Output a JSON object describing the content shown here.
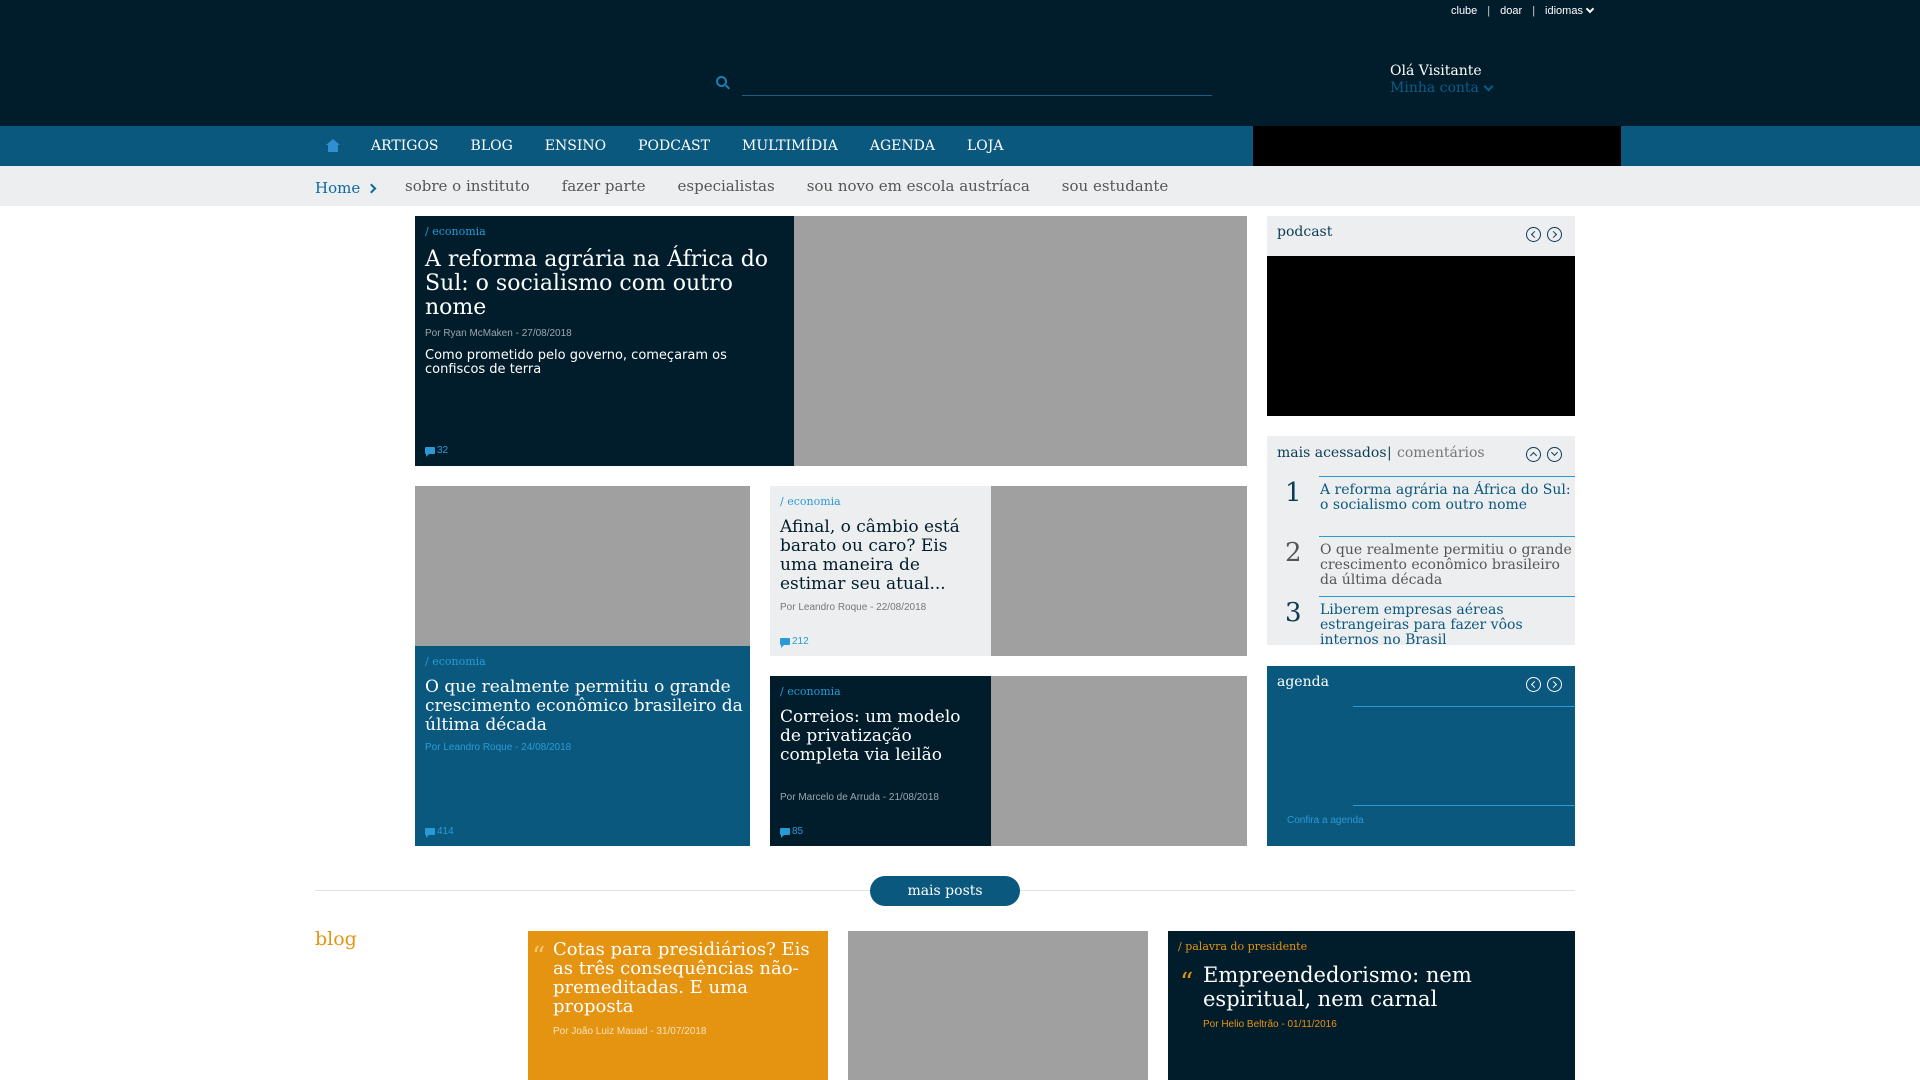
{
  "top_links": {
    "clube": "clube",
    "doar": "doar",
    "idiomas": "idiomas",
    "sep": "|"
  },
  "search": {
    "placeholder": ""
  },
  "user": {
    "greeting": "Olá Visitante",
    "account": "Minha conta"
  },
  "nav": {
    "items": [
      "ARTIGOS",
      "BLOG",
      "ENSINO",
      "PODCAST",
      "MULTIMÍDIA",
      "AGENDA",
      "LOJA"
    ]
  },
  "subnav": {
    "home": "Home",
    "links": [
      "sobre o instituto",
      "fazer parte",
      "especialistas",
      "sou novo em escola austríaca",
      "sou estudante"
    ]
  },
  "featured": {
    "main": {
      "tag": "/ economia",
      "title": "A reforma agrária na África do Sul: o socialismo com outro nome",
      "meta": "Por Ryan McMaken - 27/08/2018",
      "excerpt": "Como prometido pelo governo, começaram os confiscos de terra",
      "comments": "32"
    },
    "second": {
      "tag": "/ economia",
      "title": "O que realmente permitiu o grande crescimento econômico brasileiro da última década",
      "meta": "Por Leandro Roque - 24/08/2018",
      "comments": "414"
    },
    "third": {
      "tag": "/ economia",
      "title": "Afinal, o câmbio está barato ou caro? Eis uma maneira de estimar seu atual...",
      "meta": "Por Leandro Roque - 22/08/2018",
      "comments": "212"
    },
    "fourth": {
      "tag": "/ economia",
      "title": "Correios: um modelo de privatização completa via leilão",
      "meta": "Por Marcelo de Arruda - 21/08/2018",
      "comments": "85"
    }
  },
  "sidebar": {
    "podcast": {
      "title": "podcast"
    },
    "mais": {
      "tab_active": "mais acessados",
      "tab_sep": "|",
      "tab_other": "comentários",
      "items": [
        {
          "num": "1",
          "text": "A reforma agrária na África do Sul: o socialismo com outro nome"
        },
        {
          "num": "2",
          "text": "O que realmente permitiu o grande crescimento econômico brasileiro da última década"
        },
        {
          "num": "3",
          "text": "Liberem empresas aéreas estrangeiras para fazer vôos internos no Brasil"
        }
      ]
    },
    "agenda": {
      "title": "agenda",
      "link": "Confira a agenda"
    }
  },
  "more_posts": {
    "label": "mais posts"
  },
  "blog": {
    "section_title": "blog",
    "quote_mark": "“",
    "post1": {
      "title": "Cotas para presidiários? Eis as três consequências não-premeditadas. E uma proposta",
      "meta": "Por João Luiz Mauad - 31/07/2018"
    },
    "post2": {
      "tag": "/ palavra do presidente",
      "title": "Empreendedorismo: nem espiritual, nem carnal",
      "meta": "Por Helio Beltrão - 01/11/2016"
    }
  },
  "colors": {
    "header_bg": "#011d2c",
    "nav_bg": "#0b587e",
    "accent": "#2a9ad6",
    "orange": "#e59412"
  }
}
